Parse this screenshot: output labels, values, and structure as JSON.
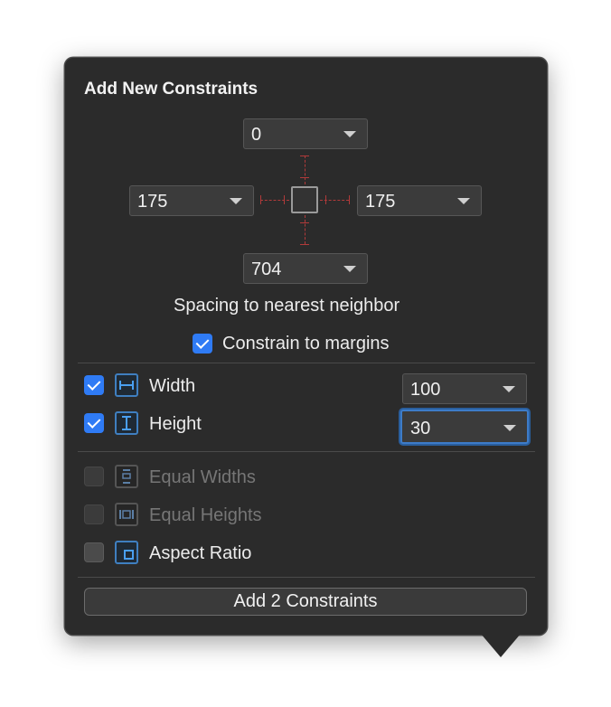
{
  "panel": {
    "title": "Add New Constraints",
    "spacing": {
      "top": "0",
      "left": "175",
      "right": "175",
      "bottom": "704"
    },
    "spacing_caption": "Spacing to nearest neighbor",
    "constrain_to_margins": {
      "label": "Constrain to margins",
      "checked": true
    },
    "width": {
      "label": "Width",
      "checked": true,
      "value": "100"
    },
    "height": {
      "label": "Height",
      "checked": true,
      "value": "30"
    },
    "equal_widths": {
      "label": "Equal Widths",
      "checked": false,
      "enabled": false
    },
    "equal_heights": {
      "label": "Equal Heights",
      "checked": false,
      "enabled": false
    },
    "aspect_ratio": {
      "label": "Aspect Ratio",
      "checked": false,
      "enabled": true
    },
    "add_button": "Add 2 Constraints"
  },
  "colors": {
    "accent": "#2f7bf5",
    "constraint_guide": "#b13a3a",
    "panel_bg": "#2b2b2b"
  }
}
